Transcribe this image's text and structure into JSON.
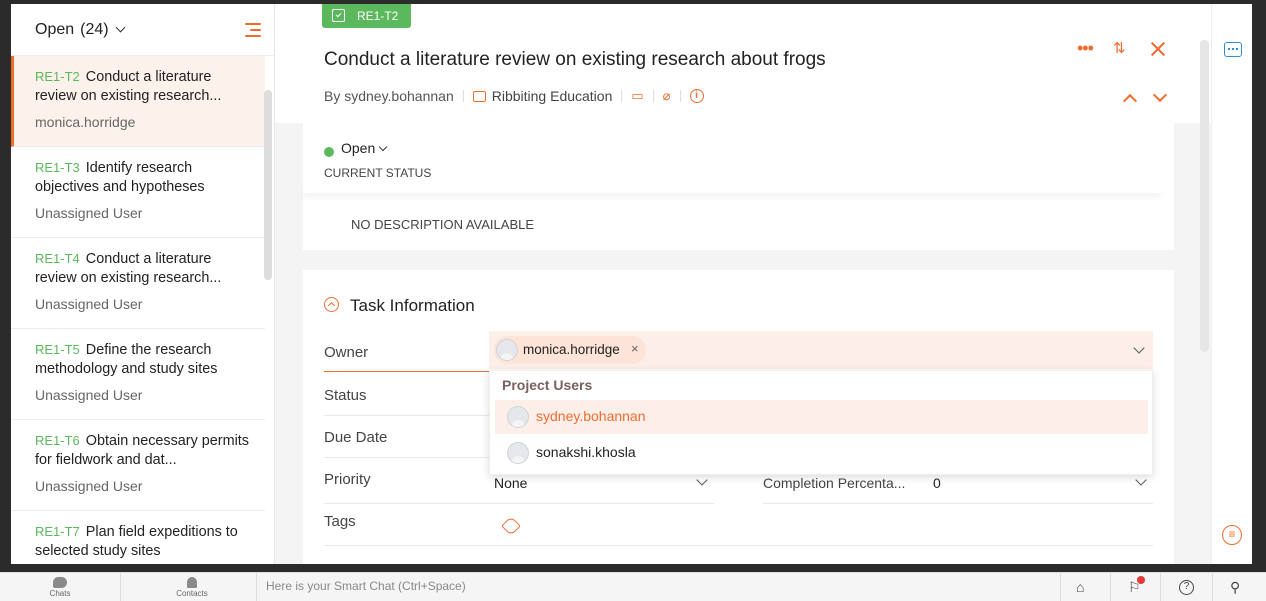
{
  "left_panel": {
    "filter_label": "Open",
    "filter_count": "(24)",
    "tasks": [
      {
        "id": "RE1-T2",
        "title": "Conduct a literature review on existing research...",
        "user": "monica.horridge"
      },
      {
        "id": "RE1-T3",
        "title": "Identify research objectives and hypotheses",
        "user": "Unassigned User"
      },
      {
        "id": "RE1-T4",
        "title": "Conduct a literature review on existing research...",
        "user": "Unassigned User"
      },
      {
        "id": "RE1-T5",
        "title": "Define the research methodology and study sites",
        "user": "Unassigned User"
      },
      {
        "id": "RE1-T6",
        "title": "Obtain necessary permits for fieldwork and dat...",
        "user": "Unassigned User"
      },
      {
        "id": "RE1-T7",
        "title": "Plan field expeditions to selected study sites",
        "user": ""
      }
    ]
  },
  "task": {
    "tag": "RE1-T2",
    "title": "Conduct a literature review on existing research about frogs",
    "author": "By sydney.bohannan",
    "project": "Ribbiting Education",
    "status": "Open",
    "status_label": "CURRENT STATUS",
    "description": "NO DESCRIPTION AVAILABLE"
  },
  "task_info": {
    "heading": "Task Information",
    "owner_label": "Owner",
    "owner_chip": "monica.horridge",
    "status_label": "Status",
    "due_date_label": "Due Date",
    "priority_label": "Priority",
    "priority_value": "None",
    "completion_label": "Completion Percenta...",
    "completion_value": "0",
    "tags_label": "Tags"
  },
  "dropdown": {
    "header": "Project Users",
    "users": [
      "sydney.bohannan",
      "sonakshi.khosla"
    ]
  },
  "taskbar": {
    "chats": "Chats",
    "contacts": "Contacts",
    "smart_chat": "Here is your Smart Chat (Ctrl+Space)"
  },
  "colors": {
    "accent": "#ef6c2f",
    "status_open": "#5cb85c",
    "chat_blue": "#2d8fdc"
  },
  "icons": [
    "menu-icon",
    "clipboard-icon",
    "briefcase-icon",
    "comment-icon",
    "attachment-icon",
    "info-icon",
    "more-icon",
    "share-icon",
    "close-icon",
    "chevron-up-icon",
    "chevron-down-icon",
    "chat-icon",
    "collapse-icon",
    "tag-icon",
    "help-icon",
    "search-icon"
  ]
}
